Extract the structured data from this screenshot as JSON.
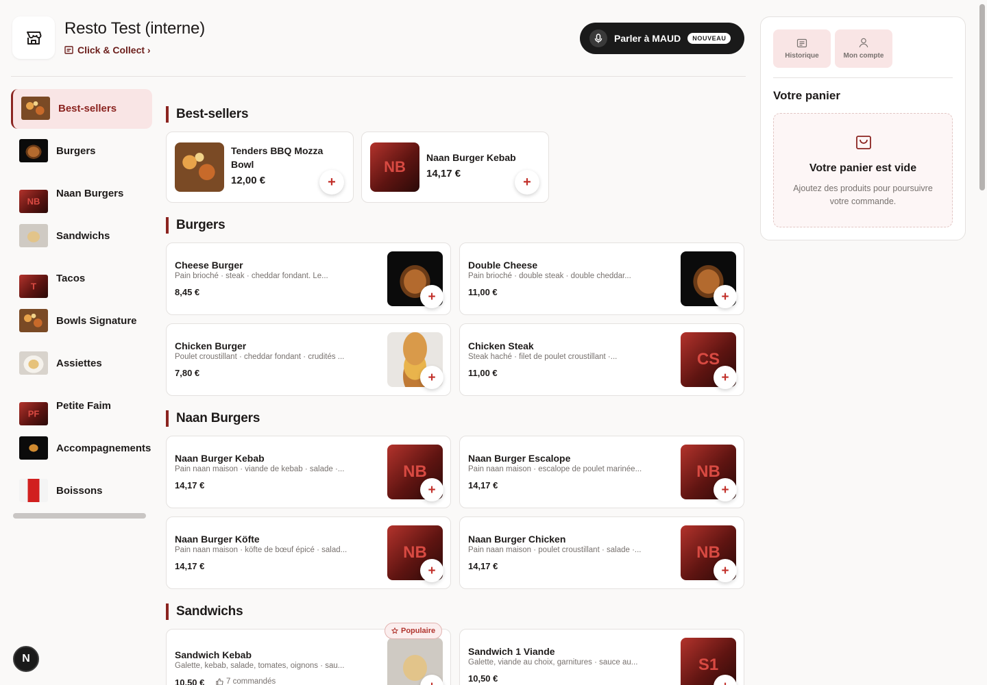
{
  "header": {
    "title": "Resto Test (interne)",
    "mode_link": "Click & Collect ›",
    "voice_button": "Parler à MAUD",
    "voice_badge": "NOUVEAU"
  },
  "sidebar": {
    "items": [
      {
        "label": "Best-sellers",
        "active": true
      },
      {
        "label": "Burgers"
      },
      {
        "label": "Naan Burgers"
      },
      {
        "label": "Sandwichs"
      },
      {
        "label": "Tacos"
      },
      {
        "label": "Bowls Signature"
      },
      {
        "label": "Assiettes"
      },
      {
        "label": "Petite Faim"
      },
      {
        "label": "Accompagnements"
      },
      {
        "label": "Boissons"
      }
    ],
    "thumb_monograms": {
      "naan": "NB",
      "tacos": "T",
      "petite": "PF"
    }
  },
  "sections": {
    "bestsellers": {
      "title": "Best-sellers",
      "items": [
        {
          "name": "Tenders BBQ Mozza Bowl",
          "price": "12,00 €"
        },
        {
          "name": "Naan Burger Kebab",
          "price": "14,17 €",
          "monogram": "NB"
        }
      ]
    },
    "burgers": {
      "title": "Burgers",
      "items": [
        {
          "name": "Cheese Burger",
          "desc": "Pain brioché · steak · cheddar fondant. Le...",
          "price": "8,45 €"
        },
        {
          "name": "Double Cheese",
          "desc": "Pain brioché · double steak · double cheddar...",
          "price": "11,00 €"
        },
        {
          "name": "Chicken Burger",
          "desc": "Poulet croustillant · cheddar fondant · crudités ...",
          "price": "7,80 €"
        },
        {
          "name": "Chicken Steak",
          "desc": "Steak haché · filet de poulet croustillant ·...",
          "price": "11,00 €",
          "monogram": "CS"
        }
      ]
    },
    "naan": {
      "title": "Naan Burgers",
      "items": [
        {
          "name": "Naan Burger Kebab",
          "desc": "Pain naan maison · viande de kebab · salade ·...",
          "price": "14,17 €",
          "monogram": "NB"
        },
        {
          "name": "Naan Burger Escalope",
          "desc": "Pain naan maison · escalope de poulet marinée...",
          "price": "14,17 €",
          "monogram": "NB"
        },
        {
          "name": "Naan Burger Köfte",
          "desc": "Pain naan maison · köfte de bœuf épicé · salad...",
          "price": "14,17 €",
          "monogram": "NB"
        },
        {
          "name": "Naan Burger Chicken",
          "desc": "Pain naan maison · poulet croustillant · salade ·...",
          "price": "14,17 €",
          "monogram": "NB"
        }
      ]
    },
    "sandwichs": {
      "title": "Sandwichs",
      "items": [
        {
          "name": "Sandwich Kebab",
          "desc": "Galette, kebab, salade, tomates, oignons · sau...",
          "price": "10,50 €",
          "badge": "Populaire",
          "orders": "7 commandés"
        },
        {
          "name": "Sandwich 1 Viande",
          "desc": "Galette, viande au choix, garnitures · sauce au...",
          "price": "10,50 €",
          "monogram": "S1"
        }
      ]
    }
  },
  "add_symbol": "+",
  "cart": {
    "history_label": "Historique",
    "account_label": "Mon compte",
    "title": "Votre panier",
    "empty_title": "Votre panier est vide",
    "empty_text": "Ajoutez des produits pour poursuivre votre commande."
  },
  "dev_badge": "N",
  "colors": {
    "brand": "#8b2420",
    "accent_bg": "#f9e5e5",
    "add_icon": "#c2302a"
  }
}
